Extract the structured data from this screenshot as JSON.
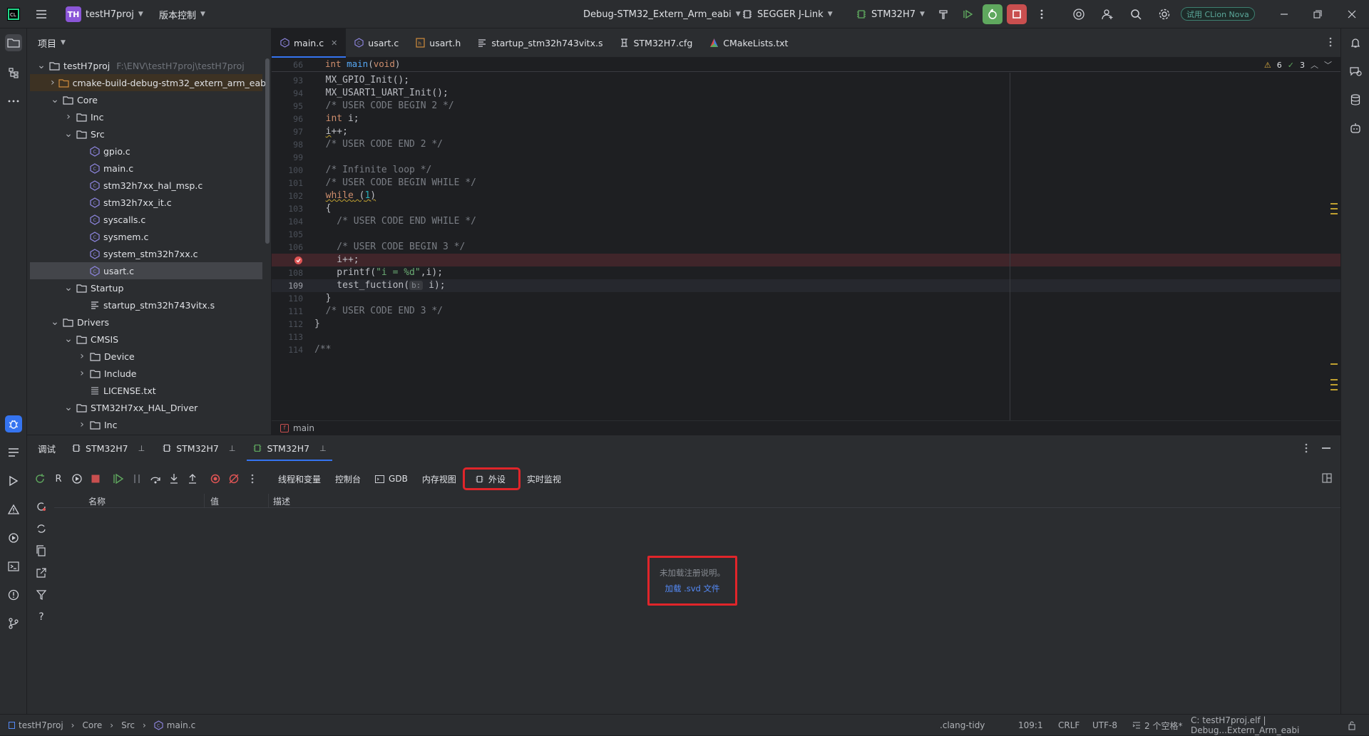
{
  "titlebar": {
    "project_initials": "TH",
    "project_name": "testH7proj",
    "vcs_label": "版本控制",
    "run_config": "Debug-STM32_Extern_Arm_eabi",
    "debugger": "SEGGER J-Link",
    "target": "STM32H7",
    "trial_badge": "试用 CLion Nova"
  },
  "project_panel": {
    "title": "项目",
    "tree": [
      {
        "label": "testH7proj",
        "path": "F:\\ENV\\testH7proj\\testH7proj",
        "type": "root",
        "expanded": true
      },
      {
        "label": "cmake-build-debug-stm32_extern_arm_eabi",
        "type": "folder-excluded",
        "expanded": false
      },
      {
        "label": "Core",
        "type": "folder",
        "expanded": true
      },
      {
        "label": "Inc",
        "type": "folder",
        "expanded": false
      },
      {
        "label": "Src",
        "type": "folder",
        "expanded": true
      },
      {
        "label": "gpio.c",
        "type": "c-file"
      },
      {
        "label": "main.c",
        "type": "c-file"
      },
      {
        "label": "stm32h7xx_hal_msp.c",
        "type": "c-file"
      },
      {
        "label": "stm32h7xx_it.c",
        "type": "c-file"
      },
      {
        "label": "syscalls.c",
        "type": "c-file"
      },
      {
        "label": "sysmem.c",
        "type": "c-file"
      },
      {
        "label": "system_stm32h7xx.c",
        "type": "c-file"
      },
      {
        "label": "usart.c",
        "type": "c-file",
        "selected": true
      },
      {
        "label": "Startup",
        "type": "folder",
        "expanded": true
      },
      {
        "label": "startup_stm32h743vitx.s",
        "type": "asm-file"
      },
      {
        "label": "Drivers",
        "type": "folder",
        "expanded": true
      },
      {
        "label": "CMSIS",
        "type": "folder",
        "expanded": true
      },
      {
        "label": "Device",
        "type": "folder",
        "expanded": false
      },
      {
        "label": "Include",
        "type": "folder",
        "expanded": false
      },
      {
        "label": "LICENSE.txt",
        "type": "txt-file"
      },
      {
        "label": "STM32H7xx_HAL_Driver",
        "type": "folder",
        "expanded": true
      },
      {
        "label": "Inc",
        "type": "folder",
        "expanded": false
      }
    ]
  },
  "editor": {
    "tabs": [
      {
        "label": "main.c",
        "active": true
      },
      {
        "label": "usart.c"
      },
      {
        "label": "usart.h"
      },
      {
        "label": "startup_stm32h743vitx.s"
      },
      {
        "label": "STM32H7.cfg"
      },
      {
        "label": "CMakeLists.txt"
      }
    ],
    "sticky_line_num": "66",
    "sticky_line": "int main(void)",
    "warnings_count": "6",
    "ok_count": "3",
    "line_numbers": [
      "93",
      "94",
      "95",
      "96",
      "97",
      "98",
      "99",
      "100",
      "101",
      "102",
      "103",
      "104",
      "105",
      "106",
      "107",
      "108",
      "109",
      "110",
      "111",
      "112",
      "113",
      "114"
    ],
    "lines": [
      {
        "code": "  MX_GPIO_Init();"
      },
      {
        "code": "  MX_USART1_UART_Init();"
      },
      {
        "code": "  /* USER CODE BEGIN 2 */"
      },
      {
        "code": "  int i;"
      },
      {
        "code": "  i++;"
      },
      {
        "code": "  /* USER CODE END 2 */"
      },
      {
        "code": ""
      },
      {
        "code": "  /* Infinite loop */"
      },
      {
        "code": "  /* USER CODE BEGIN WHILE */"
      },
      {
        "code": "  while (1)"
      },
      {
        "code": "  {"
      },
      {
        "code": "    /* USER CODE END WHILE */"
      },
      {
        "code": ""
      },
      {
        "code": "    /* USER CODE BEGIN 3 */"
      },
      {
        "code": "    i++;"
      },
      {
        "code": "    printf(\"i = %d\",i);"
      },
      {
        "code": "    test_fuction(",
        "hint": "b:",
        "rest": "i);"
      },
      {
        "code": "  }"
      },
      {
        "code": "  /* USER CODE END 3 */"
      },
      {
        "code": "}"
      },
      {
        "code": ""
      },
      {
        "code": "/**"
      }
    ],
    "breadcrumb": "main"
  },
  "debug_panel": {
    "title": "调试",
    "sessions": [
      "STM32H7",
      "STM32H7",
      "STM32H7"
    ],
    "subtabs": [
      "线程和变量",
      "控制台",
      "GDB",
      "内存视图",
      "外设",
      "实时监视"
    ],
    "columns": [
      "名称",
      "值",
      "描述"
    ],
    "empty_message": "未加载注册说明。",
    "load_link": "加载 .svd 文件"
  },
  "statusbar": {
    "crumbs": [
      "testH7proj",
      "Core",
      "Src",
      "main.c"
    ],
    "clang_tidy": ".clang-tidy",
    "position": "109:1",
    "line_ending": "CRLF",
    "encoding": "UTF-8",
    "indent": "2 个空格*",
    "context": "C: testH7proj.elf | Debug...Extern_Arm_eabi"
  },
  "colors": {
    "accent": "#3574f0",
    "highlight_box": "#e0252a",
    "breakpoint": "#e05555",
    "run_green": "#5fa85e",
    "stop_red": "#c94f4f"
  }
}
